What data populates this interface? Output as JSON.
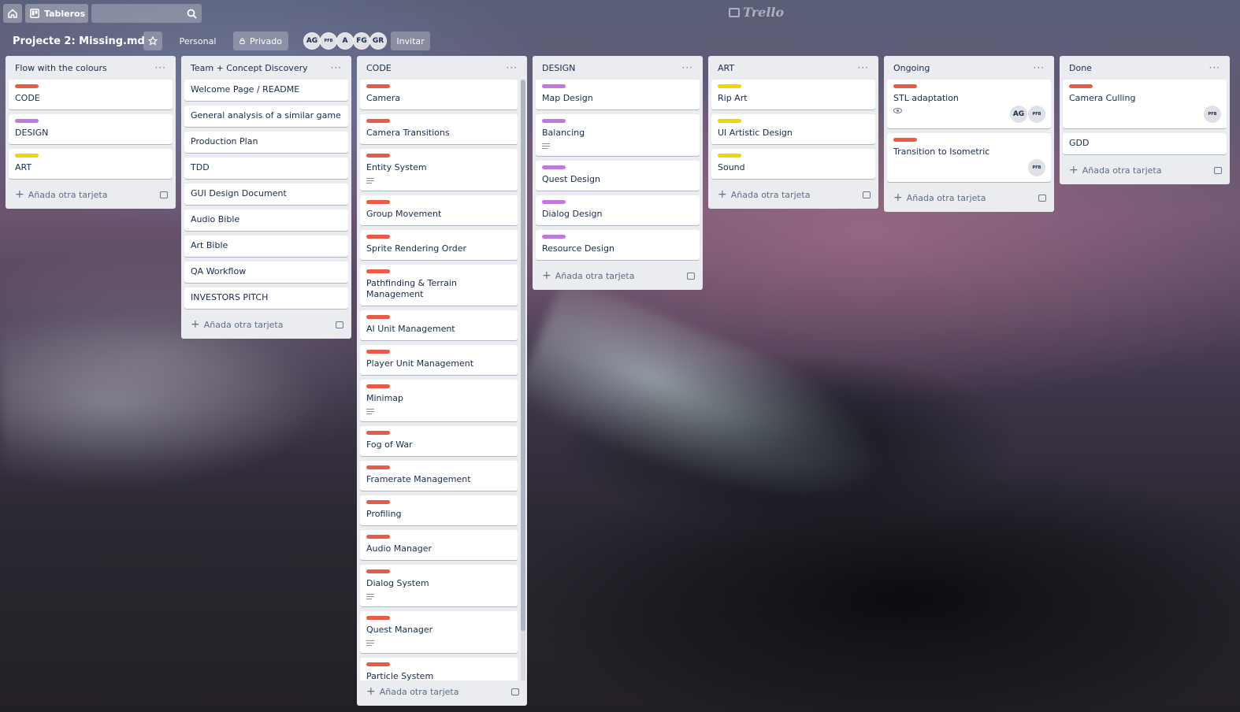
{
  "topbar": {
    "boards_label": "Tableros",
    "logo_text": "Trello"
  },
  "board": {
    "title": "Projecte 2: Missing.md",
    "personal_label": "Personal",
    "privacy_label": "Privado",
    "invite_label": "Invitar",
    "members": [
      "AG",
      "PFB",
      "A",
      "FG",
      "GR"
    ]
  },
  "colors": {
    "red": "#eb5a46",
    "purple": "#c377e0",
    "yellow": "#f2d600"
  },
  "add_card_label": "Añada otra tarjeta",
  "lists": [
    {
      "title": "Flow with the colours",
      "cards": [
        {
          "label": "red",
          "text": "CODE"
        },
        {
          "label": "purple",
          "text": "DESIGN"
        },
        {
          "label": "yellow",
          "text": "ART"
        }
      ]
    },
    {
      "title": "Team + Concept Discovery",
      "cards": [
        {
          "text": "Welcome Page / README"
        },
        {
          "text": "General analysis of a similar game"
        },
        {
          "text": "Production Plan"
        },
        {
          "text": "TDD"
        },
        {
          "text": "GUI Design Document"
        },
        {
          "text": "Audio Bible"
        },
        {
          "text": "Art Bible"
        },
        {
          "text": "QA Workflow"
        },
        {
          "text": "INVESTORS PITCH"
        }
      ]
    },
    {
      "title": "CODE",
      "cards": [
        {
          "label": "red",
          "text": "Camera"
        },
        {
          "label": "red",
          "text": "Camera Transitions"
        },
        {
          "label": "red",
          "text": "Entity System",
          "desc": true
        },
        {
          "label": "red",
          "text": "Group Movement"
        },
        {
          "label": "red",
          "text": "Sprite Rendering Order"
        },
        {
          "label": "red",
          "text": "Pathfinding & Terrain Management"
        },
        {
          "label": "red",
          "text": "AI Unit Management"
        },
        {
          "label": "red",
          "text": "Player Unit Management"
        },
        {
          "label": "red",
          "text": "Minimap",
          "desc": true
        },
        {
          "label": "red",
          "text": "Fog of War"
        },
        {
          "label": "red",
          "text": "Framerate Management"
        },
        {
          "label": "red",
          "text": "Profiling"
        },
        {
          "label": "red",
          "text": "Audio Manager"
        },
        {
          "label": "red",
          "text": "Dialog System",
          "desc": true
        },
        {
          "label": "red",
          "text": "Quest Manager",
          "desc": true
        },
        {
          "label": "red",
          "text": "Particle System",
          "desc": true
        }
      ]
    },
    {
      "title": "DESIGN",
      "cards": [
        {
          "label": "purple",
          "text": "Map Design"
        },
        {
          "label": "purple",
          "text": "Balancing",
          "desc": true
        },
        {
          "label": "purple",
          "text": "Quest Design"
        },
        {
          "label": "purple",
          "text": "Dialog Design"
        },
        {
          "label": "purple",
          "text": "Resource Design"
        }
      ]
    },
    {
      "title": "ART",
      "cards": [
        {
          "label": "yellow",
          "text": "Rip Art"
        },
        {
          "label": "yellow",
          "text": "UI Artistic Design"
        },
        {
          "label": "yellow",
          "text": "Sound"
        }
      ]
    },
    {
      "title": "Ongoing",
      "cards": [
        {
          "label": "red",
          "text": "STL adaptation",
          "watch": true,
          "members": [
            "AG",
            "PFB"
          ]
        },
        {
          "label": "red",
          "text": "Transition to Isometric",
          "members": [
            "PFB"
          ]
        }
      ]
    },
    {
      "title": "Done",
      "cards": [
        {
          "label": "red",
          "text": "Camera Culling",
          "members": [
            "PFB"
          ]
        },
        {
          "text": "GDD"
        }
      ]
    }
  ]
}
